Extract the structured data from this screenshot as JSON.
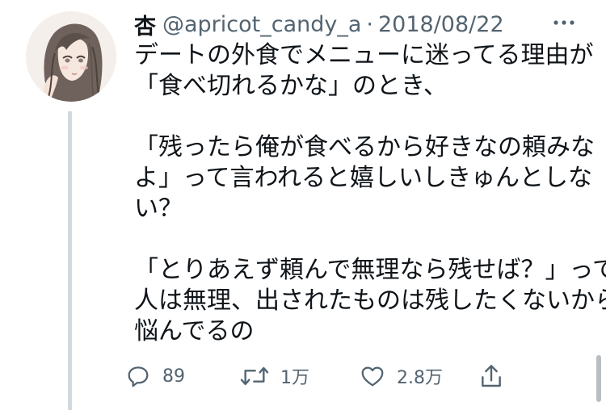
{
  "tweet": {
    "display_name": "杏",
    "handle": "@apricot_candy_a",
    "separator": "·",
    "date": "2018/08/22",
    "lines": [
      "デートの外食でメニューに迷ってる理由が",
      "「食べ切れるかな」のとき、",
      "",
      "「残ったら俺が食べるから好きなの頼みな",
      "よ」って言われると嬉しいしきゅんとしな",
      "い？",
      "",
      "「とりあえず頼んで無理なら残せば？」って",
      "人は無理、出されたものは残したくないから",
      "悩んでるの"
    ]
  },
  "actions": {
    "reply_count": "89",
    "retweet_count": "1万",
    "like_count": "2.8万"
  },
  "icons": {
    "more": "more-dots-icon",
    "reply": "reply-icon",
    "retweet": "retweet-icon",
    "like": "heart-icon",
    "share": "share-icon"
  },
  "colors": {
    "text": "#0f1419",
    "muted": "#536471",
    "thread_line": "#cfd9de"
  }
}
